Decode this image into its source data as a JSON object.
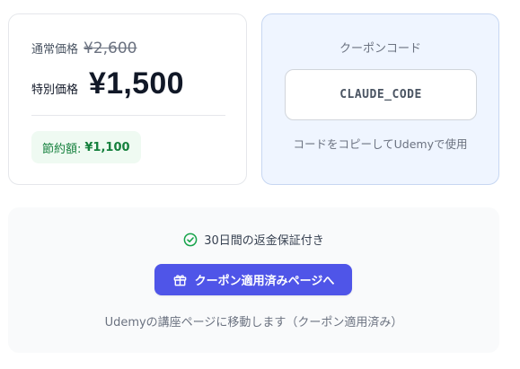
{
  "pricing": {
    "regular_label": "通常価格",
    "regular_price": "¥2,600",
    "special_label": "特別価格",
    "special_price": "¥1,500",
    "savings_label": "節約額:",
    "savings_amount": "¥1,100"
  },
  "coupon": {
    "label": "クーポンコード",
    "code": "CLAUDE_CODE",
    "hint": "コードをコピーしてUdemyで使用"
  },
  "footer": {
    "guarantee_icon": "check-circle-icon",
    "guarantee_text": "30日間の返金保証付き",
    "cta_icon": "gift-icon",
    "cta_label": "クーポン適用済みページへ",
    "note": "Udemyの講座ページに移動します（クーポン適用済み）"
  },
  "colors": {
    "accent": "#4f55e8",
    "success": "#15803d",
    "coupon_bg": "#eff5ff"
  }
}
